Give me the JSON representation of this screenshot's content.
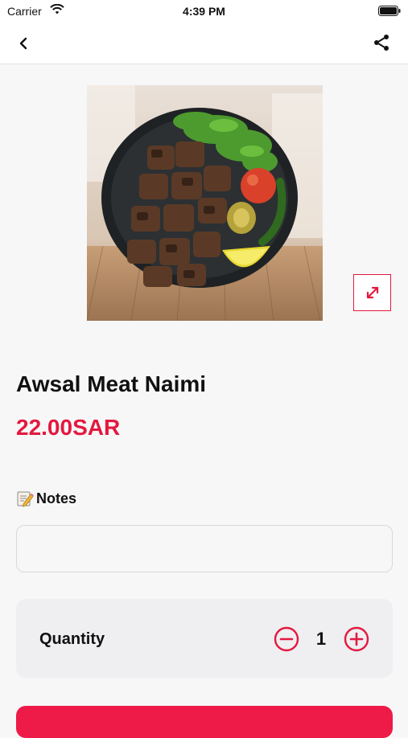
{
  "status_bar": {
    "carrier": "Carrier",
    "time": "4:39 PM"
  },
  "nav": {
    "back_icon": "chevron-left-icon",
    "share_icon": "share-icon"
  },
  "product": {
    "title": "Awsal Meat Naimi",
    "price": "22.00SAR",
    "image_alt": "Grilled meat cubes on a black plate with arugula, tomato, pepper and lemon"
  },
  "notes": {
    "label": "Notes",
    "value": "",
    "placeholder": ""
  },
  "quantity": {
    "label": "Quantity",
    "value": "1"
  },
  "colors": {
    "accent": "#e3193f",
    "button": "#ee1a48",
    "card_bg": "#efeef1"
  }
}
